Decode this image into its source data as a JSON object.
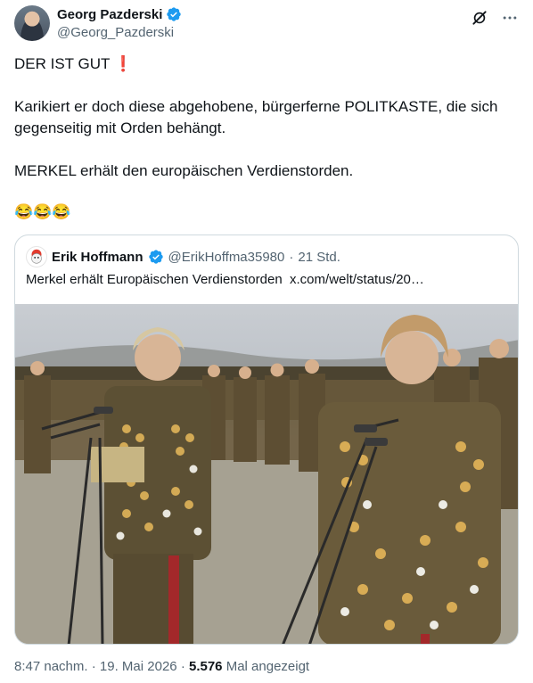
{
  "tweet": {
    "author_name": "Georg Pazderski",
    "author_handle": "@Georg_Pazderski",
    "lines": [
      "DER IST GUT ❗",
      "Karikiert er doch diese abgehobene, bürgerferne POLITKASTE, die sich gegenseitig mit Orden behängt.",
      "MERKEL erhält den europäischen Verdienstorden.",
      "😂😂😂"
    ]
  },
  "header_icons": [
    "grok-icon",
    "more-icon"
  ],
  "quote": {
    "author_name": "Erik Hoffmann",
    "author_handle": "@ErikHoffma35980",
    "separator": "·",
    "time": "21 Std.",
    "text": "Merkel erhält Europäischen Verdienstorden",
    "link": "x.com/welt/status/20…"
  },
  "footer": {
    "time": "8:47 nachm.",
    "sep1": "·",
    "date": "19. Mai 2026",
    "sep2": "·",
    "views_count": "5.576",
    "views_label": "Mal angezeigt"
  },
  "colors": {
    "verified_blue": "#1d9bf0",
    "text_primary": "#0f1419",
    "text_secondary": "#536471",
    "border": "#cfd9de"
  }
}
